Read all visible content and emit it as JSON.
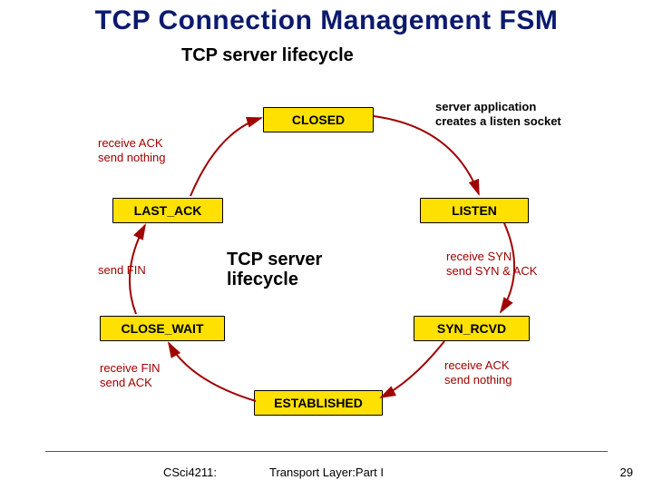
{
  "slide": {
    "title": "TCP Connection Management FSM",
    "subtitle": "TCP server lifecycle",
    "center_label": "TCP server\nlifecycle"
  },
  "states": {
    "closed": "CLOSED",
    "listen": "LISTEN",
    "syn_rcvd": "SYN_RCVD",
    "established": "ESTABLISHED",
    "close_wait": "CLOSE_WAIT",
    "last_ack": "LAST_ACK"
  },
  "transitions": {
    "closed_to_listen": "server application\ncreates a listen socket",
    "listen_to_synrcvd": "receive SYN\nsend SYN & ACK",
    "synrcvd_to_est": "receive  ACK\nsend nothing",
    "est_to_closewait": "receive FIN\nsend ACK",
    "closewait_to_lastack": "send  FIN",
    "lastack_to_closed": "receive  ACK\nsend nothing"
  },
  "footer": {
    "left": "CSci4211:",
    "center": "Transport Layer:Part I",
    "page": "29"
  }
}
